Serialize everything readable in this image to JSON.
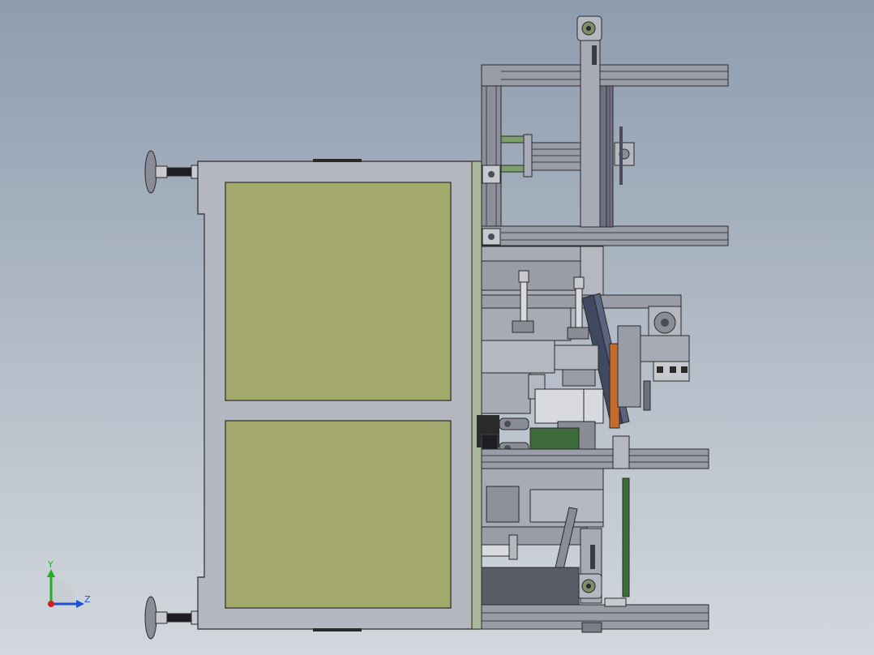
{
  "viewport": {
    "background_top": "#8e9cae",
    "background_bottom": "#d3d8de"
  },
  "colors": {
    "panel_fill": "#a3a86d",
    "frame_fill": "#b4b7bf",
    "frame_stroke": "#2a2a2a",
    "extrusion_fill": "#9a9da8",
    "rail_fill": "#6d7080",
    "metal_dark": "#4b4e5a",
    "orange_part": "#c46a2a",
    "green_part": "#7ca06a",
    "pcb_green": "#3d6b3a",
    "axis_y": "#20b020",
    "axis_z": "#2050d0",
    "axis_x": "#d02020"
  },
  "triad": {
    "y_label": "Y",
    "z_label": "Z",
    "icon": "coordinate-triad-icon"
  }
}
